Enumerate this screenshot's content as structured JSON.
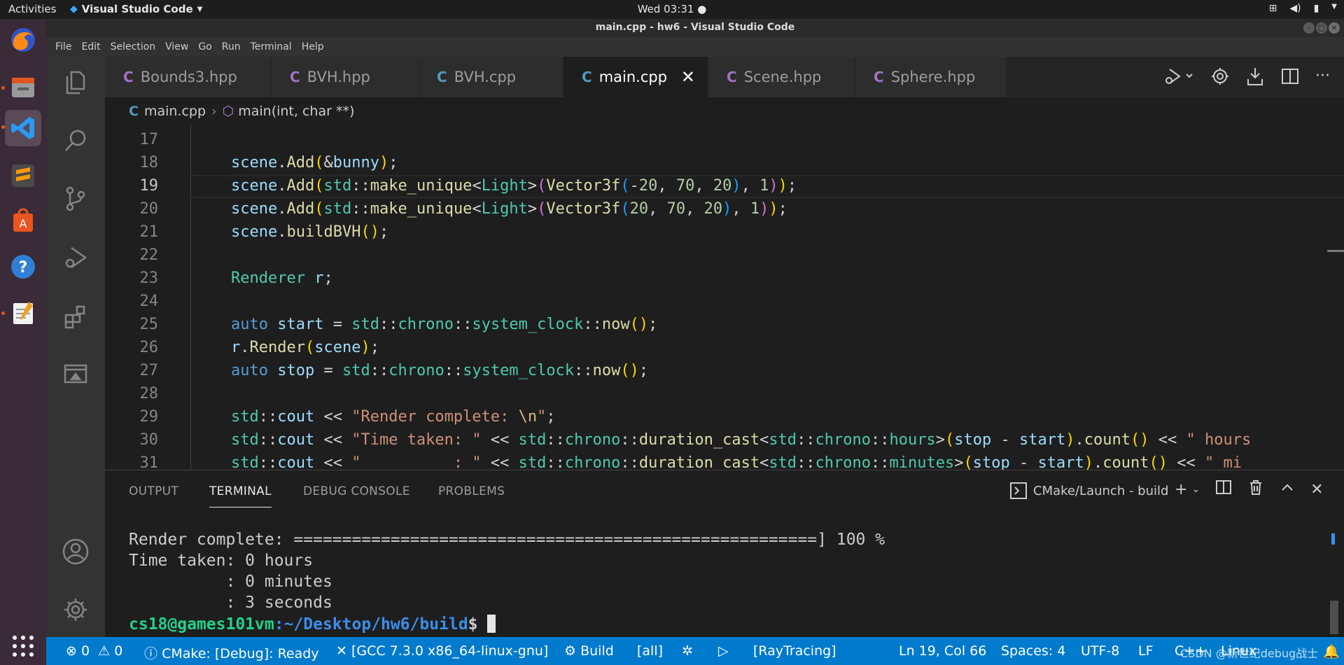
{
  "topbar": {
    "activities": "Activities",
    "app_name": "Visual Studio Code",
    "clock": "Wed 03:31"
  },
  "window": {
    "title": "main.cpp - hw6 - Visual Studio Code"
  },
  "menu": {
    "items": [
      "File",
      "Edit",
      "Selection",
      "View",
      "Go",
      "Run",
      "Terminal",
      "Help"
    ]
  },
  "tabs": [
    {
      "label": "Bounds3.hpp",
      "active": false
    },
    {
      "label": "BVH.hpp",
      "active": false
    },
    {
      "label": "BVH.cpp",
      "active": false
    },
    {
      "label": "main.cpp",
      "active": true
    },
    {
      "label": "Scene.hpp",
      "active": false
    },
    {
      "label": "Sphere.hpp",
      "active": false
    }
  ],
  "breadcrumb": {
    "file": "main.cpp",
    "symbol": "main(int, char **)"
  },
  "editor": {
    "current_line": 19,
    "line_numbers": [
      "17",
      "18",
      "19",
      "20",
      "21",
      "22",
      "23",
      "24",
      "25",
      "26",
      "27",
      "28",
      "29",
      "30",
      "31"
    ]
  },
  "panel": {
    "tabs": [
      "OUTPUT",
      "TERMINAL",
      "DEBUG CONSOLE",
      "PROBLEMS"
    ],
    "active_tab": "TERMINAL",
    "terminal_name": "CMake/Launch - build",
    "lines": [
      "Render complete: ======================================================] 100 %",
      "Time taken: 0 hours",
      "          : 0 minutes",
      "          : 3 seconds"
    ],
    "prompt_user": "cs18@games101vm",
    "prompt_path": ":~/Desktop/hw6/build",
    "prompt_symbol": "$"
  },
  "statusbar": {
    "errors": "0",
    "warnings": "0",
    "cmake_status": "CMake: [Debug]: Ready",
    "kit": "[GCC 7.3.0 x86_64-linux-gnu]",
    "build": "Build",
    "target": "[all]",
    "launch_target": "[RayTracing]",
    "position": "Ln 19, Col 66",
    "spaces": "Spaces: 4",
    "encoding": "UTF-8",
    "eol": "LF",
    "language": "C++",
    "platform": "Linux"
  },
  "watermark": "CSDN @新世纪debug战士",
  "colors": {
    "accent": "#007acc",
    "dock": "#3b2a37",
    "prompt_user": "#23d18b",
    "prompt_path": "#3b8eea"
  }
}
